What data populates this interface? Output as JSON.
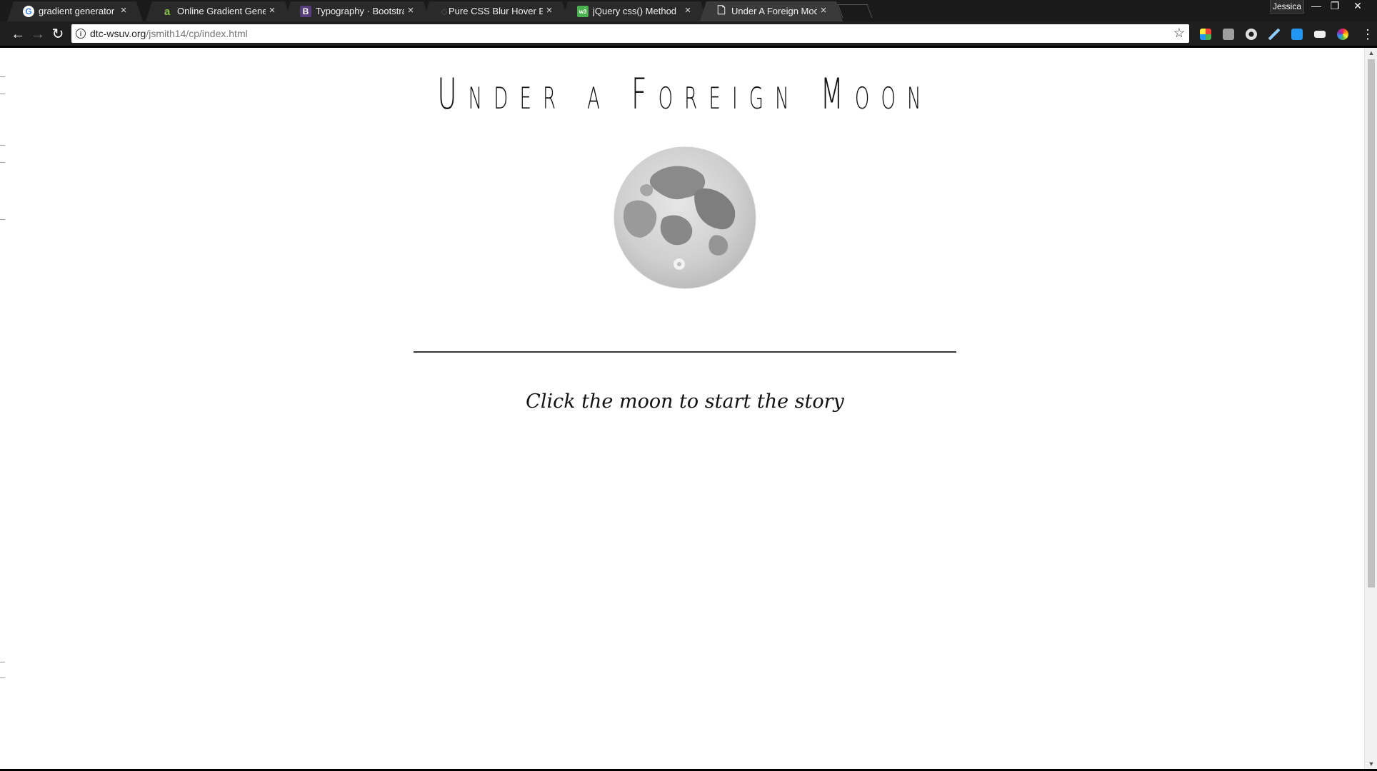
{
  "browser": {
    "tabs": [
      {
        "label": "gradient generator back",
        "favicon": "google-icon",
        "active": false
      },
      {
        "label": "Online Gradient Generat",
        "favicon": "a-logo-icon",
        "active": false
      },
      {
        "label": "Typography · Bootstrap",
        "favicon": "bootstrap-icon",
        "active": false
      },
      {
        "label": "Pure CSS Blur Hover Effe",
        "favicon": "codepen-icon",
        "active": false
      },
      {
        "label": "jQuery css() Method",
        "favicon": "w3schools-icon",
        "active": false
      },
      {
        "label": "Under A Foreign Moon",
        "favicon": "page-icon",
        "active": true
      }
    ],
    "profile_name": "Jessica",
    "window_controls": {
      "minimize": "—",
      "restore": "❐",
      "close": "✕"
    },
    "address": {
      "domain": "dtc-wsuv.org",
      "path": "/jsmith14/cp/index.html"
    },
    "nav": {
      "back": "←",
      "forward": "→",
      "reload": "↻"
    },
    "extensions": [
      {
        "name": "color-grid-extension-icon",
        "color": "#4caf50"
      },
      {
        "name": "font-extension-icon",
        "color": "#9e9e9e"
      },
      {
        "name": "gear-extension-icon",
        "color": "#e0e0e0"
      },
      {
        "name": "pen-extension-icon",
        "color": "#90caf9"
      },
      {
        "name": "css3-extension-icon",
        "color": "#2196f3"
      },
      {
        "name": "window-extension-icon",
        "color": "#eeeeee"
      },
      {
        "name": "color-wheel-extension-icon",
        "color": "#e91e63"
      }
    ]
  },
  "page": {
    "title": "Under a Foreign Moon",
    "tagline": "Click the moon to start the story",
    "colors": {
      "background": "#ffffff",
      "text": "#111111",
      "moon_light": "#d9d9d9",
      "moon_dark": "#8a8a8a"
    }
  }
}
